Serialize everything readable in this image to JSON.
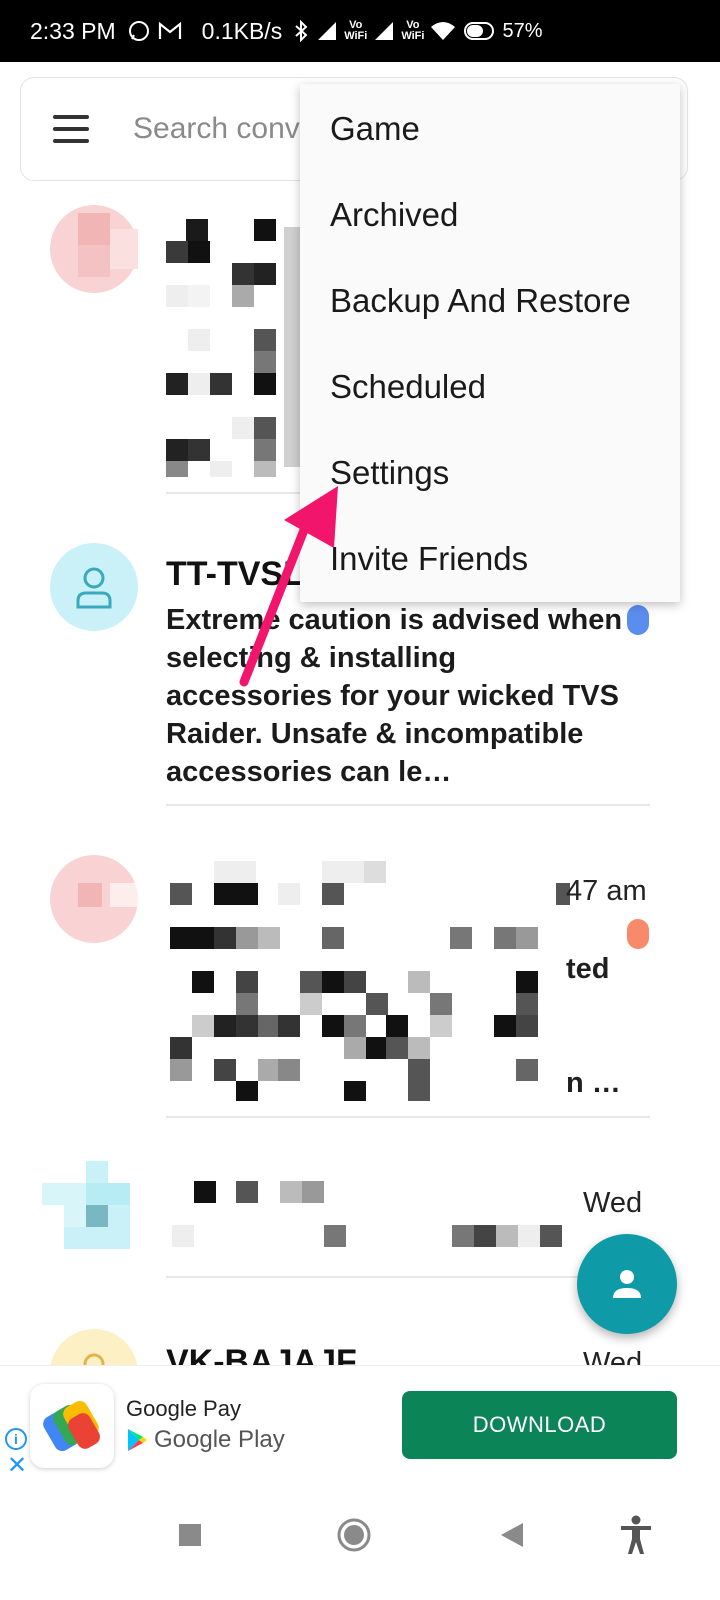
{
  "status_bar": {
    "time": "2:33 PM",
    "speed": "0.1KB/s",
    "vowifi_top": "Vo",
    "vowifi_bottom": "WiFi",
    "battery": "57%"
  },
  "search": {
    "placeholder": "Search conversations"
  },
  "menu": {
    "items": [
      "Game",
      "Archived",
      "Backup And Restore",
      "Scheduled",
      "Settings",
      "Invite Friends"
    ]
  },
  "conversations": [
    {
      "title": "TT-TVSL",
      "snippet": "Extreme caution is advised when selecting & installing accessories for your wicked TVS Raider. Unsafe & incompatible accessories can le…",
      "dot_color": "#5b8def"
    },
    {
      "time": "47 am",
      "snippet_tail_1": "ted",
      "snippet_tail_2": "n …",
      "dot_color": "#f78a6a"
    },
    {
      "time": "Wed"
    },
    {
      "title": "VK-BAJAJF",
      "time": "Wed"
    }
  ],
  "ad": {
    "app_name": "Google Pay",
    "store": "Google Play",
    "cta": "DOWNLOAD"
  },
  "colors": {
    "accent": "#0e9aa7",
    "arrow": "#f1166b",
    "download": "#0b8457"
  }
}
